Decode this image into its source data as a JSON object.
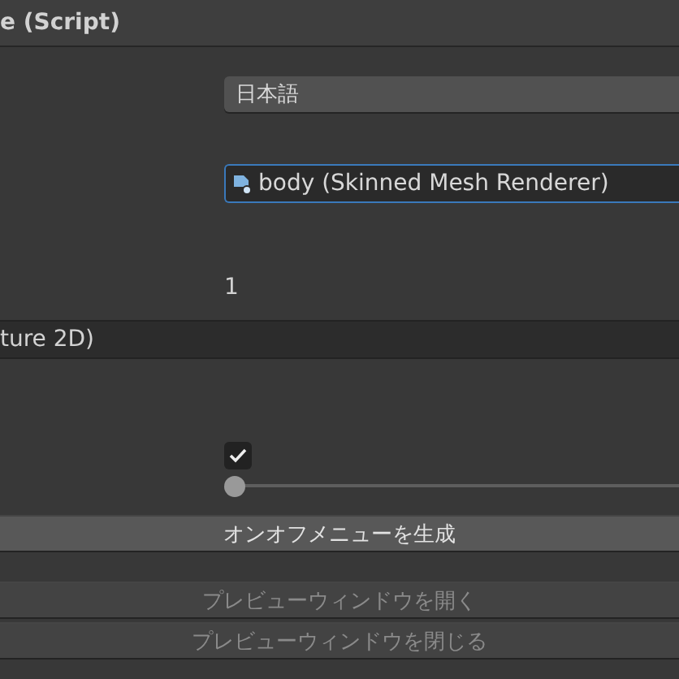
{
  "component_header": {
    "title": "e (Script)"
  },
  "language_dropdown": {
    "value": "日本語"
  },
  "renderer_field": {
    "value": "body (Skinned Mesh Renderer)"
  },
  "count_value": "1",
  "section_header": {
    "title": "ture 2D)"
  },
  "toggle": {
    "checked": true
  },
  "slider": {
    "level": 0
  },
  "buttons": [
    {
      "label": "オンオフメニューを生成",
      "disabled": false
    },
    {
      "label": "プレビューウィンドウを開く",
      "disabled": true
    },
    {
      "label": "プレビューウィンドウを閉じる",
      "disabled": true
    }
  ]
}
